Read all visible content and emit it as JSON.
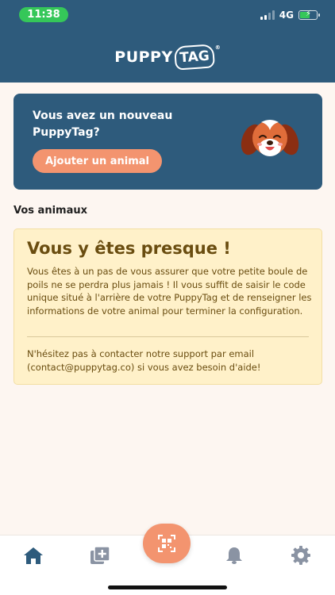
{
  "status_bar": {
    "time": "11:38",
    "network": "4G"
  },
  "header": {
    "logo_word": "PUPPY",
    "logo_tag": "TAG",
    "logo_reg": "®"
  },
  "promo": {
    "text": "Vous avez un nouveau PuppyTag?",
    "button_label": "Ajouter un animal"
  },
  "section": {
    "title": "Vos animaux"
  },
  "notice": {
    "title": "Vous y êtes presque !",
    "body": "Vous êtes à un pas de vous assurer que votre petite boule de poils ne se perdra plus jamais ! Il vous suffit de saisir le code unique situé à l'arrière de votre PuppyTag et de renseigner les informations de votre animal pour terminer la configuration.",
    "support": "N'hésitez pas à contacter notre support par email (contact@puppytag.co) si vous avez besoin d'aide!"
  },
  "tabbar": {
    "items": [
      {
        "icon": "home-icon"
      },
      {
        "icon": "add-pet-icon"
      },
      {
        "icon": "qr-scan-icon"
      },
      {
        "icon": "bell-icon"
      },
      {
        "icon": "gear-icon"
      }
    ]
  },
  "colors": {
    "brand_blue": "#2e5b7c",
    "accent_orange": "#f3946f",
    "notice_bg": "#fff1c9",
    "notice_text": "#6a4d10"
  }
}
